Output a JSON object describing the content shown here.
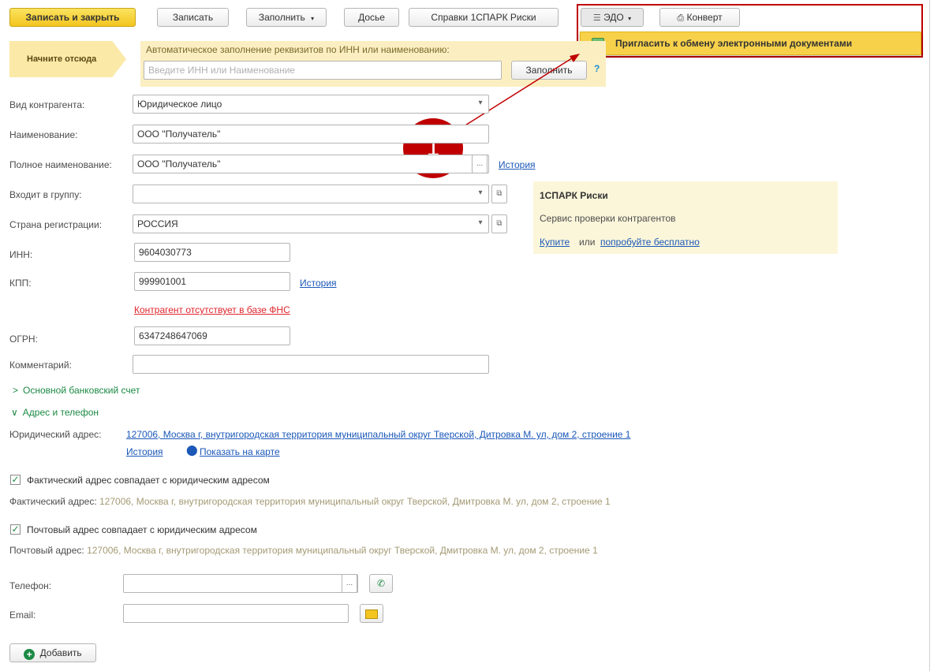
{
  "toolbar": {
    "save_close": "Записать и закрыть",
    "save": "Записать",
    "fill": "Заполнить",
    "dossier": "Досье",
    "spark": "Справки 1СПАРК Риски",
    "edo": "ЭДО",
    "envelope": "Конверт"
  },
  "edo_menu": {
    "invite": "Пригласить к обмену электронными документами"
  },
  "start_banner": {
    "start_here": "Начните отсюда",
    "hint": "Автоматическое заполнение реквизитов по ИНН или наименованию:",
    "placeholder": "Введите ИНН или Наименование",
    "fill_button": "Заполнить",
    "help": "?"
  },
  "callout": {
    "number": "1",
    "color": "#c00000"
  },
  "form": {
    "kind_label": "Вид контрагента:",
    "kind_value": "Юридическое лицо",
    "name_label": "Наименование:",
    "name_value": "ООО \"Получатель\"",
    "full_name_label": "Полное наименование:",
    "full_name_value": "ООО \"Получатель\"",
    "full_name_ellipsis": "...",
    "history": "История",
    "group_label": "Входит в группу:",
    "group_value": "",
    "country_label": "Страна регистрации:",
    "country_value": "РОССИЯ",
    "inn_label": "ИНН:",
    "inn_value": "9604030773",
    "kpp_label": "КПП:",
    "kpp_value": "999901001",
    "kpp_history": "История",
    "fns_warning": "Контрагент отсутствует в базе ФНС",
    "ogrn_label": "ОГРН:",
    "ogrn_value": "6347248647069",
    "comment_label": "Комментарий:",
    "comment_value": ""
  },
  "spark_panel": {
    "title": "1СПАРК Риски",
    "subtitle": "Сервис проверки контрагентов",
    "buy": "Купите",
    "or": "или",
    "try_free": "попробуйте бесплатно"
  },
  "sections": {
    "bank": "Основной банковский счет",
    "address_phone": "Адрес и телефон"
  },
  "address": {
    "legal_label": "Юридический адрес:",
    "legal_value": "127006, Москва г, внутригородская территория муниципальный округ Тверской, Дитровка М. ул, дом 2, строение 1",
    "history": "История",
    "show_map": "Показать на карте",
    "actual_same": "Фактический адрес совпадает с юридическим адресом",
    "actual_label": "Фактический адрес:",
    "actual_value": "127006, Москва г, внутригородская территория муниципальный округ Тверской, Дмитровка М. ул, дом 2, строение 1",
    "postal_same": "Почтовый адрес совпадает с юридическим адресом",
    "postal_label": "Почтовый адрес:",
    "postal_value": "127006, Москва г, внутригородская территория муниципальный округ Тверской, Дмитровка М. ул, дом 2, строение 1"
  },
  "contacts": {
    "phone_label": "Телефон:",
    "phone_value": "",
    "email_label": "Email:",
    "email_value": "",
    "ellipsis": "...",
    "add": "Добавить"
  }
}
